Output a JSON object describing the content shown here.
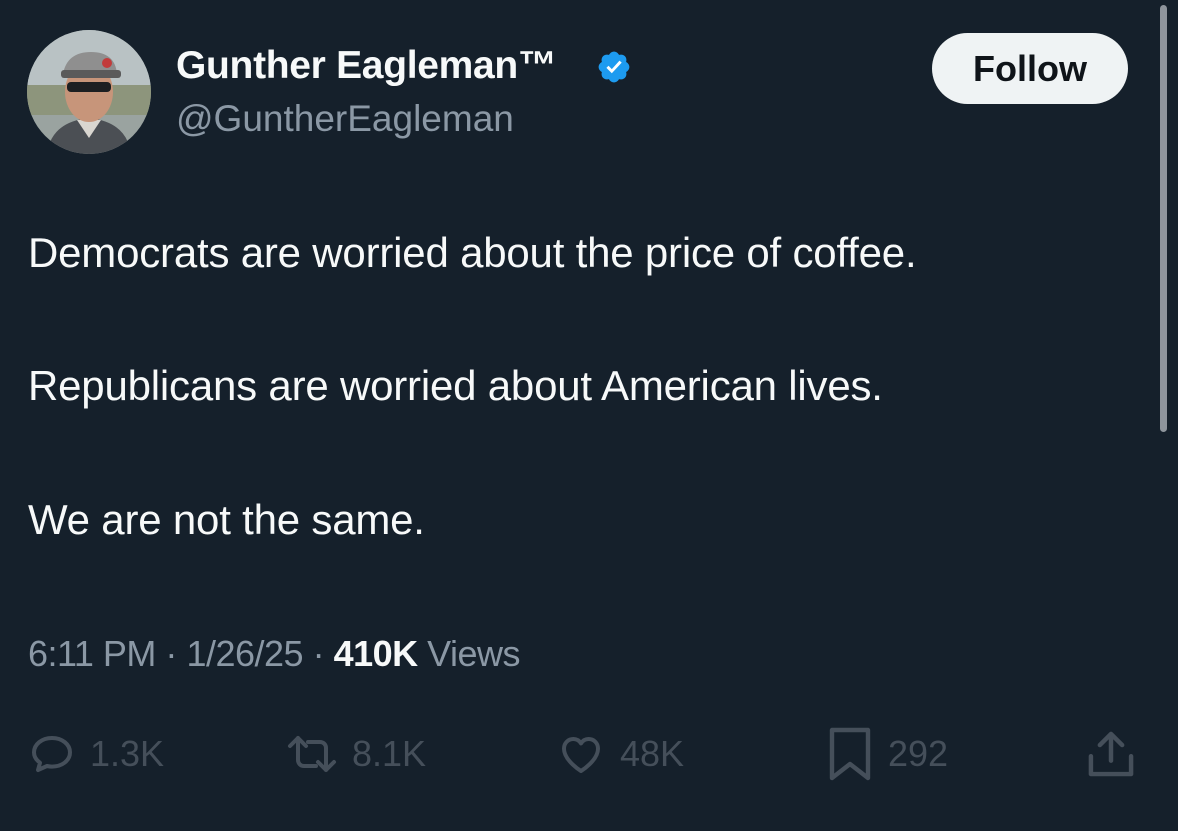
{
  "user": {
    "display_name": "Gunther Eagleman™",
    "handle": "@GuntherEagleman",
    "verified": true
  },
  "follow_button": {
    "label": "Follow"
  },
  "tweet": {
    "lines": [
      "Democrats are worried about the price of coffee.",
      "Republicans are worried about American lives.",
      "We are not the same."
    ],
    "time": "6:11 PM",
    "date": "1/26/25",
    "separator": "·",
    "views_count": "410K",
    "views_label": "Views"
  },
  "actions": {
    "reply_count": "1.3K",
    "repost_count": "8.1K",
    "like_count": "48K",
    "bookmark_count": "292"
  },
  "colors": {
    "background": "#15202b",
    "text_primary": "#f7f9f9",
    "text_secondary": "#8b98a5",
    "action_dim": "#454f5a",
    "verified_badge": "#1d9bf0",
    "follow_button_bg": "#eff3f4"
  },
  "icons": {
    "verified": "verified-badge-icon",
    "reply": "speech-bubble-icon",
    "repost": "repost-arrows-icon",
    "like": "heart-icon",
    "bookmark": "bookmark-icon",
    "share": "share-upload-icon"
  }
}
